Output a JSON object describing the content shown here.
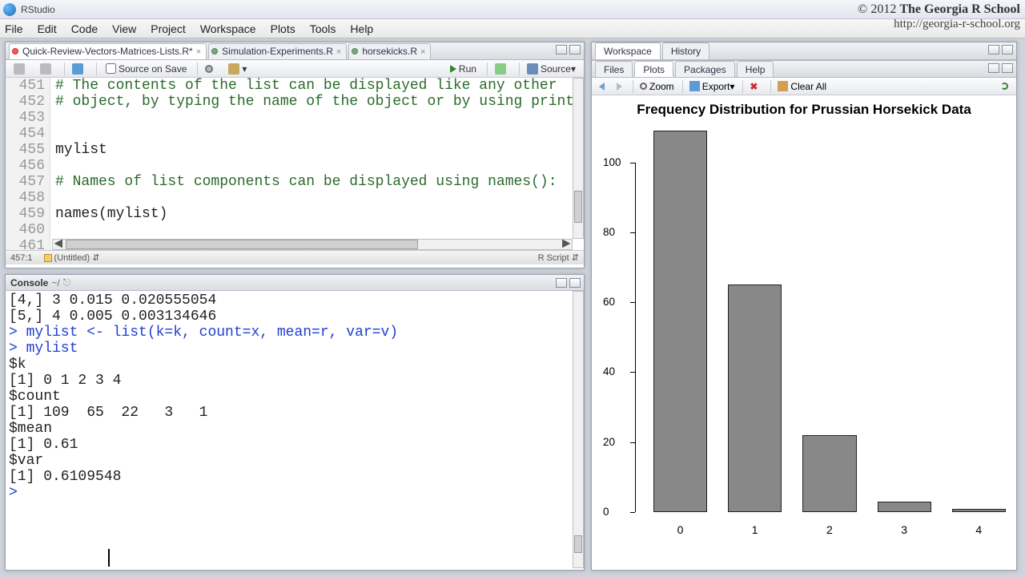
{
  "app": {
    "title": "RStudio"
  },
  "branding": {
    "line1_prefix": "© 2012 ",
    "line1_bold": "The Georgia R School",
    "line2": "http://georgia-r-school.org"
  },
  "menubar": [
    "File",
    "Edit",
    "Code",
    "View",
    "Project",
    "Workspace",
    "Plots",
    "Tools",
    "Help"
  ],
  "source": {
    "tabs": [
      {
        "label": "Quick-Review-Vectors-Matrices-Lists.R*",
        "active": true,
        "dirty": true
      },
      {
        "label": "Simulation-Experiments.R",
        "active": false,
        "dirty": false
      },
      {
        "label": "horsekicks.R",
        "active": false,
        "dirty": false
      }
    ],
    "toolbar": {
      "sourcesave": "Source on Save",
      "run": "Run",
      "source": "Source"
    },
    "first_line": 451,
    "code": [
      {
        "n": 451,
        "t": "# The contents of the list can be displayed like any other",
        "c": "comment"
      },
      {
        "n": 452,
        "t": "# object, by typing the name of the object or by using print()",
        "c": "comment"
      },
      {
        "n": 453,
        "t": "",
        "c": "plain"
      },
      {
        "n": 454,
        "t": "",
        "c": "plain"
      },
      {
        "n": 455,
        "t": "mylist",
        "c": "plain"
      },
      {
        "n": 456,
        "t": "",
        "c": "plain"
      },
      {
        "n": 457,
        "t": "# Names of list components can be displayed using names():",
        "c": "comment"
      },
      {
        "n": 458,
        "t": "",
        "c": "plain"
      },
      {
        "n": 459,
        "t": "names(mylist)",
        "c": "plain"
      },
      {
        "n": 460,
        "t": "",
        "c": "plain"
      },
      {
        "n": 461,
        "t": "",
        "c": "plain"
      }
    ],
    "status": {
      "pos": "457:1",
      "doc": "(Untitled)",
      "lang": "R Script"
    }
  },
  "console": {
    "title": "Console",
    "path": "~/",
    "lines": [
      {
        "t": "[4,] 3 0.015 0.020555054",
        "c": "plain"
      },
      {
        "t": "[5,] 4 0.005 0.003134646",
        "c": "plain"
      },
      {
        "t": "> mylist <- list(k=k, count=x, mean=r, var=v)",
        "c": "blue"
      },
      {
        "t": "> mylist",
        "c": "blue"
      },
      {
        "t": "$k",
        "c": "plain"
      },
      {
        "t": "[1] 0 1 2 3 4",
        "c": "plain"
      },
      {
        "t": "",
        "c": "plain"
      },
      {
        "t": "$count",
        "c": "plain"
      },
      {
        "t": "[1] 109  65  22   3   1",
        "c": "plain"
      },
      {
        "t": "",
        "c": "plain"
      },
      {
        "t": "$mean",
        "c": "plain"
      },
      {
        "t": "[1] 0.61",
        "c": "plain"
      },
      {
        "t": "",
        "c": "plain"
      },
      {
        "t": "$var",
        "c": "plain"
      },
      {
        "t": "[1] 0.6109548",
        "c": "plain"
      },
      {
        "t": "",
        "c": "plain"
      },
      {
        "t": "> ",
        "c": "blue"
      }
    ]
  },
  "right": {
    "upper_tabs": [
      "Workspace",
      "History"
    ],
    "upper_active": 0,
    "lower_tabs": [
      "Files",
      "Plots",
      "Packages",
      "Help"
    ],
    "lower_active": 1,
    "plot_toolbar": {
      "zoom": "Zoom",
      "export": "Export",
      "clear": "Clear All"
    }
  },
  "chart_data": {
    "type": "bar",
    "title": "Frequency Distribution for Prussian Horsekick Data",
    "categories": [
      "0",
      "1",
      "2",
      "3",
      "4"
    ],
    "values": [
      109,
      65,
      22,
      3,
      1
    ],
    "xlabel": "",
    "ylabel": "",
    "ylim": [
      0,
      110
    ],
    "yticks": [
      0,
      20,
      40,
      60,
      80,
      100
    ]
  }
}
